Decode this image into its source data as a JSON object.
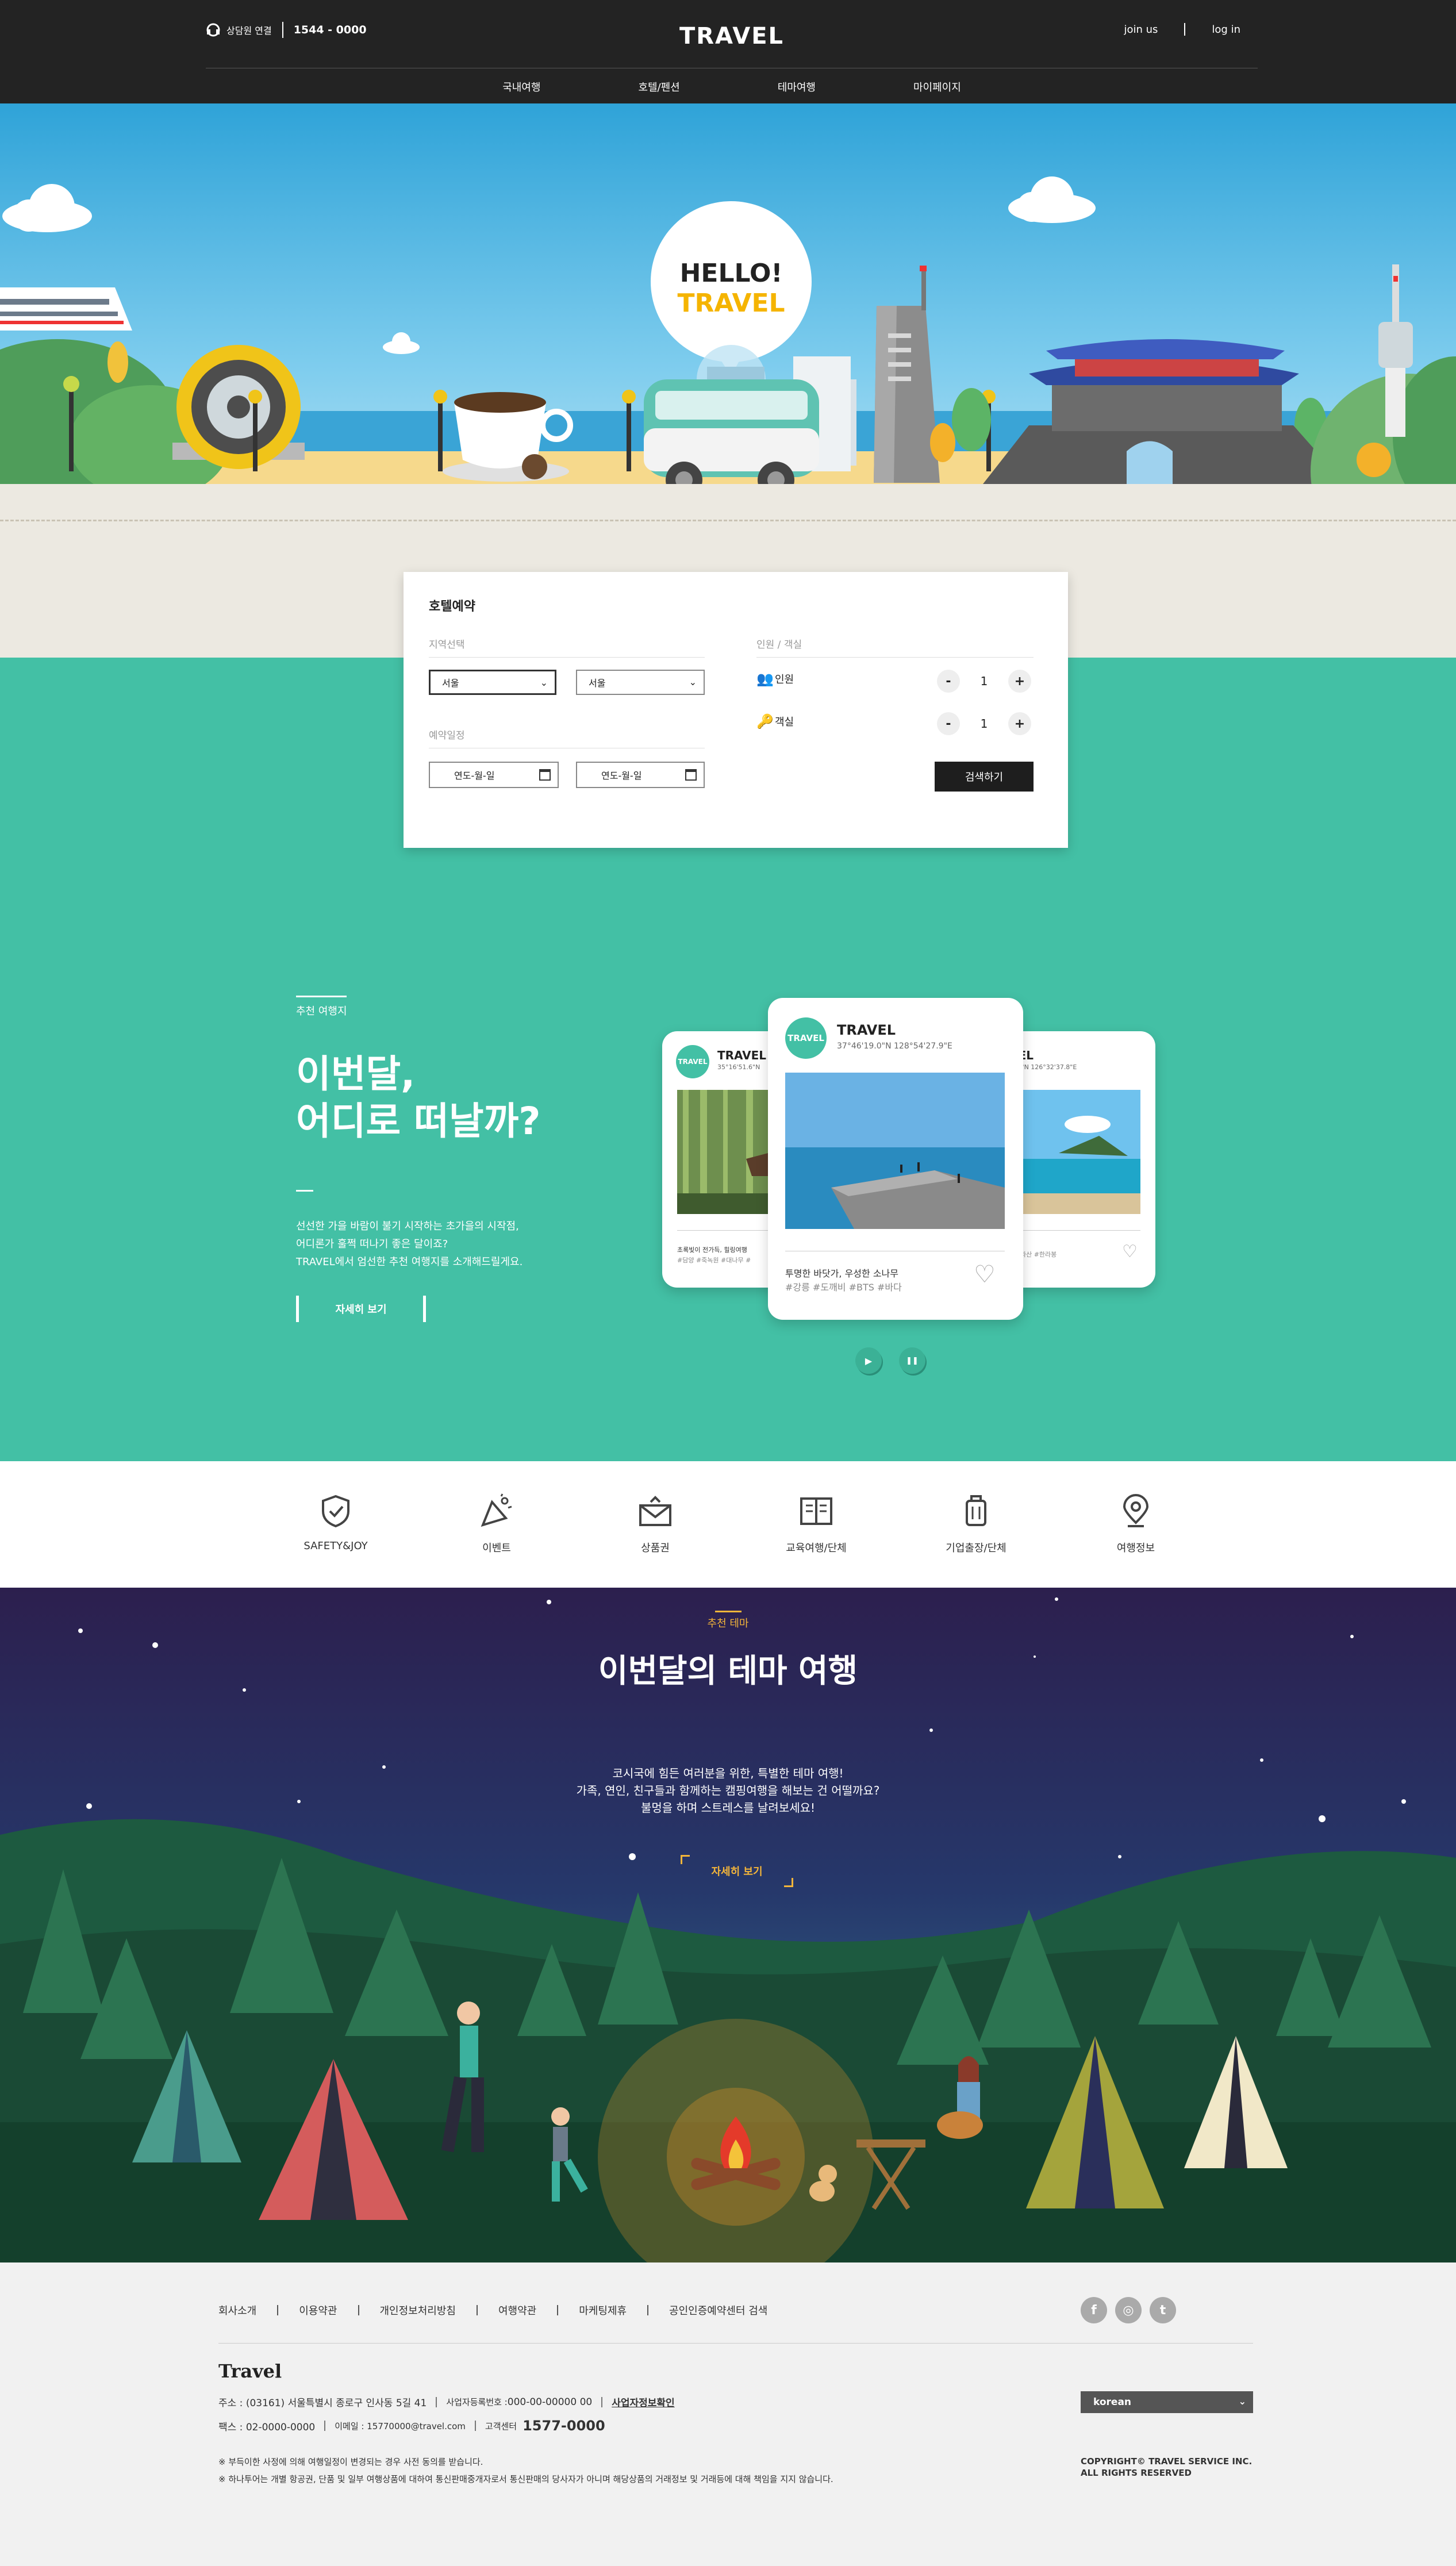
{
  "header": {
    "phone_label": "상담원 연결",
    "phone_number": "1544 - 0000",
    "logo": "TRAVEL",
    "join": "join us",
    "login": "log in",
    "nav": [
      "국내여행",
      "호텔/펜션",
      "테마여행",
      "마이페이지"
    ]
  },
  "hero": {
    "bubble_line1": "HELLO!",
    "bubble_line2": "TRAVEL"
  },
  "booking": {
    "title": "호텔예약",
    "region_label": "지역선택",
    "region_select1": "서울",
    "region_select2": "서울",
    "date_label": "예약일정",
    "date_placeholder1": "연도-월-일",
    "date_placeholder2": "연도-월-일",
    "people_label": "인원 / 객실",
    "people_row": "인원",
    "people_value": "1",
    "room_row": "객실",
    "room_value": "1",
    "minus": "-",
    "plus": "+",
    "search": "검색하기"
  },
  "recommend": {
    "tag": "추천 여행지",
    "title_line1": "이번달,",
    "title_line2": "어디로 떠날까?",
    "desc_line1": "선선한 가을 바람이 불기 시작하는 초가을의 시작점,",
    "desc_line2": "어디론가 훌쩍 떠나기 좋은 달이죠?",
    "desc_line3": "TRAVEL에서 엄선한 추천 여행지를 소개해드릴게요.",
    "more": "자세히 보기",
    "cards": [
      {
        "badge": "TRAVEL",
        "title": "TRAVEL",
        "coord": "35°16'51.6\"N",
        "desc": "초록빛이 전가득, 힐링여행",
        "tags": "#담양 #죽녹원 #대나무 #"
      },
      {
        "badge": "TRAVEL",
        "title": "TRAVEL",
        "coord": "37°46'19.0\"N 128°54'27.9\"E",
        "desc": "투명한 바닷가, 우성한 소나무",
        "tags": "#강릉 #도깨비 #BTS #바다"
      },
      {
        "badge": "TRAVEL",
        "title": "AVEL",
        "coord": "3'50.3\"N 126°32'37.8\"E",
        "desc": "",
        "tags": "을 #한라산 #한라봉"
      }
    ],
    "play_icon": "▶",
    "pause_icon": "❚❚"
  },
  "iconmenu": [
    "SAFETY&JOY",
    "이벤트",
    "상품권",
    "교육여행/단체",
    "기업출장/단체",
    "여행정보"
  ],
  "theme": {
    "tag": "추천 테마",
    "title": "이번달의 테마 여행",
    "desc_line1": "코시국에 힘든 여러분을 위한, 특별한 테마 여행!",
    "desc_line2": "가족, 연인, 친구들과 함께하는 캠핑여행을 해보는 건 어떨까요?",
    "desc_line3": "불멍을 하며 스트레스를 날려보세요!",
    "more": "자세히 보기"
  },
  "footer": {
    "links": [
      "회사소개",
      "이용약관",
      "개인정보처리방침",
      "여행약관",
      "마케팅제휴",
      "공인인증예약센터 검색"
    ],
    "sns": [
      "f",
      "◎",
      "t"
    ],
    "brand": "Travel",
    "address": "주소 : (03161) 서울특별시 종로구 인사동 5길 41",
    "biz_label": "사업자등록번호 : ",
    "biz_number": "000-00-00000 00",
    "biz_check": "사업자정보확인",
    "fax": "팩스 : 02-0000-0000",
    "email": "이메일 : 15770000@travel.com",
    "center_label": "고객센터",
    "center_number": "1577-0000",
    "notice1": "※ 부득이한 사정에 의해 여행일정이 변경되는 경우 사전 동의를 받습니다.",
    "notice2": "※ 하나투어는 개별 항공권, 단품 및 일부 여행상품에 대하여 통신판매중개자로서 통신판매의 당사자가 아니며 해당상품의 거래정보 및 거래등에 대해 책임을 지지 않습니다.",
    "language": "korean",
    "copyright1": "COPYRIGHT© TRAVEL SERVICE INC.",
    "copyright2": "ALL RIGHTS RESERVED"
  }
}
